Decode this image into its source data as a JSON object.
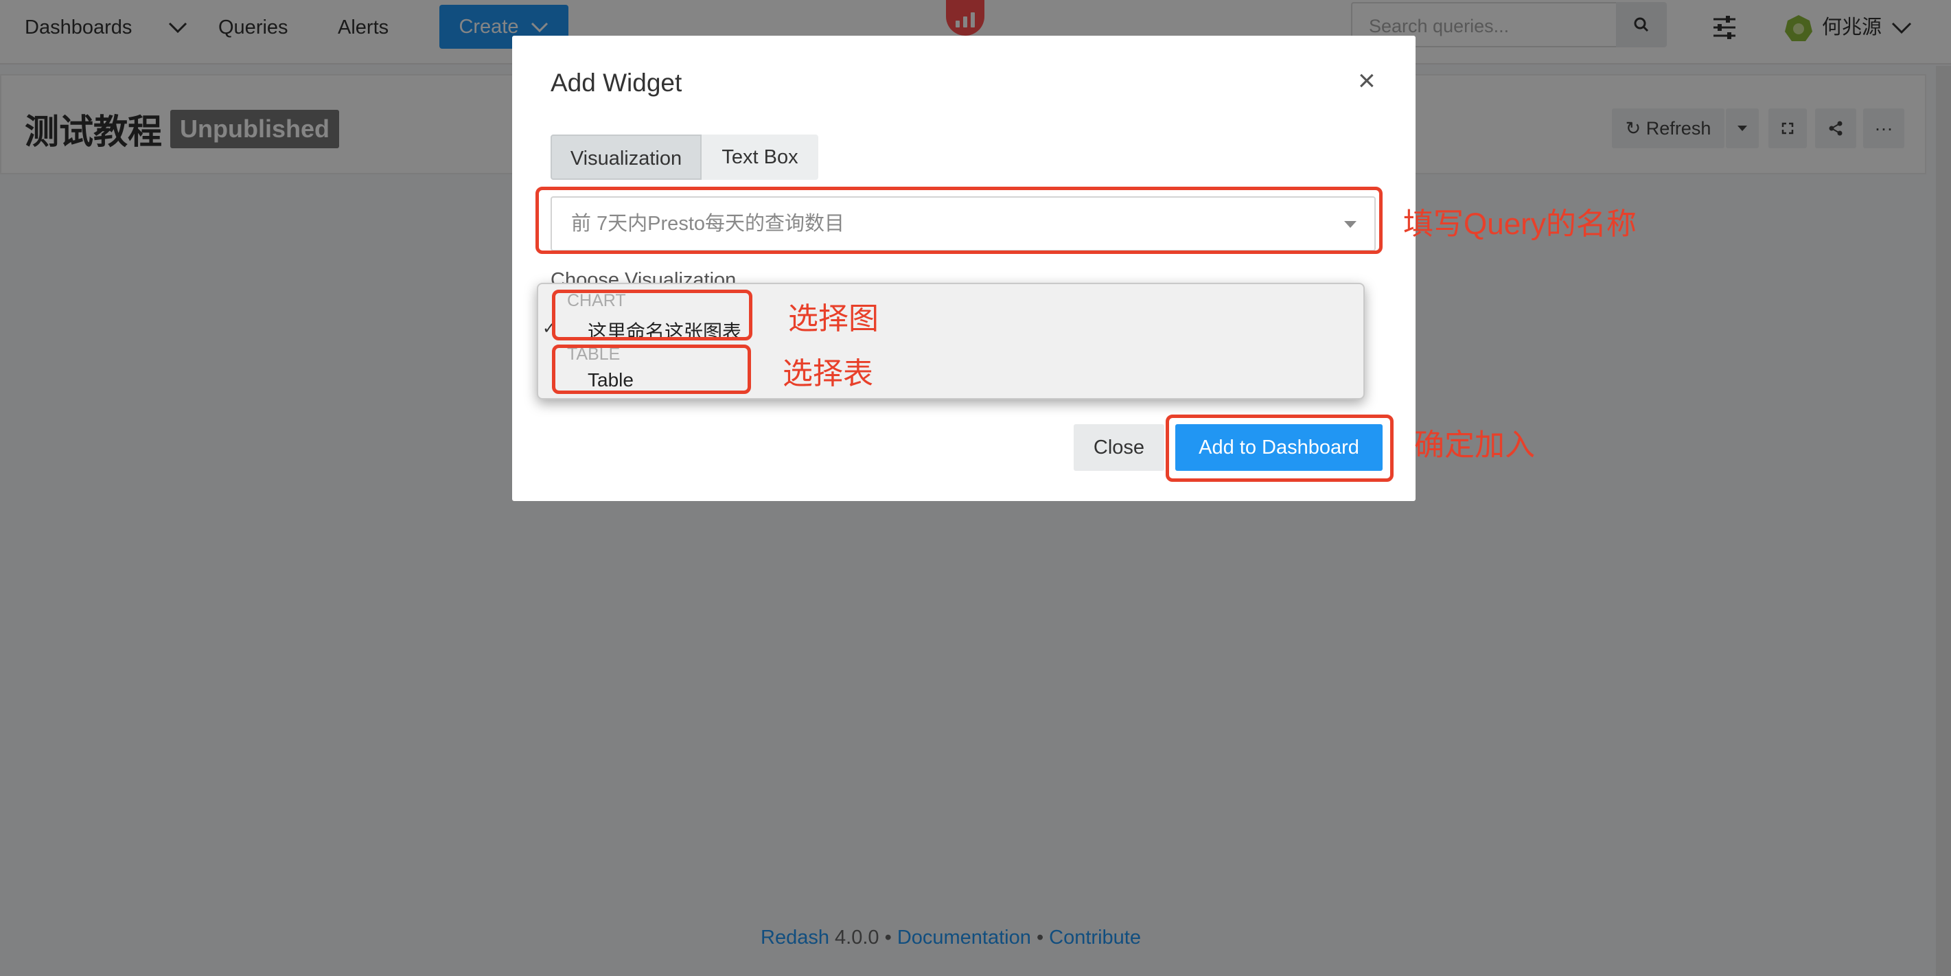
{
  "nav": {
    "dashboards": "Dashboards",
    "queries": "Queries",
    "alerts": "Alerts",
    "create": "Create",
    "search_placeholder": "Search queries...",
    "user": "何兆源"
  },
  "page": {
    "title": "测试教程",
    "badge": "Unpublished",
    "refresh": "Refresh"
  },
  "modal": {
    "title": "Add Widget",
    "close_symbol": "×",
    "tabs": [
      "Visualization",
      "Text Box"
    ],
    "query_value": "前 7天内Presto每天的查询数目",
    "choose_label": "Choose Visualization",
    "dropdown": {
      "groups": [
        {
          "label": "CHART",
          "option": "这里命名这张图表"
        },
        {
          "label": "TABLE",
          "option": "Table"
        }
      ]
    },
    "close_button": "Close",
    "add_button": "Add to Dashboard"
  },
  "annotations": {
    "query_note": "填写Query的名称",
    "chart_note": "选择图",
    "table_note": "选择表",
    "confirm_note": "确定加入"
  },
  "footer": {
    "brand": "Redash",
    "version": "4.0.0",
    "separator": "•",
    "documentation": "Documentation",
    "contribute": "Contribute"
  },
  "colors": {
    "primary": "#2196f3",
    "annotation": "#e8402a",
    "logo": "#ff4f4f"
  }
}
